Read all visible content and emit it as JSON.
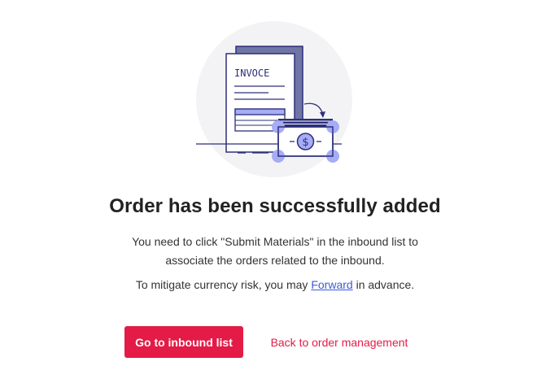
{
  "illustration": {
    "icon": "invoice-payment-illustration",
    "document_label": "INVOCE",
    "currency_symbol": "$"
  },
  "dialog": {
    "title": "Order has been successfully added",
    "description": "You need to click \"Submit Materials\" in the inbound list to associate the orders related to the inbound.",
    "hint_before": "To mitigate currency risk, you may ",
    "hint_link": "Forward",
    "hint_after": " in advance."
  },
  "actions": {
    "primary_label": "Go to inbound list",
    "secondary_label": "Back to order management"
  },
  "colors": {
    "accent": "#e31b46",
    "link": "#3e5ad6",
    "illustration_primary": "#2d2f7a",
    "illustration_accent": "#a6acf5"
  }
}
